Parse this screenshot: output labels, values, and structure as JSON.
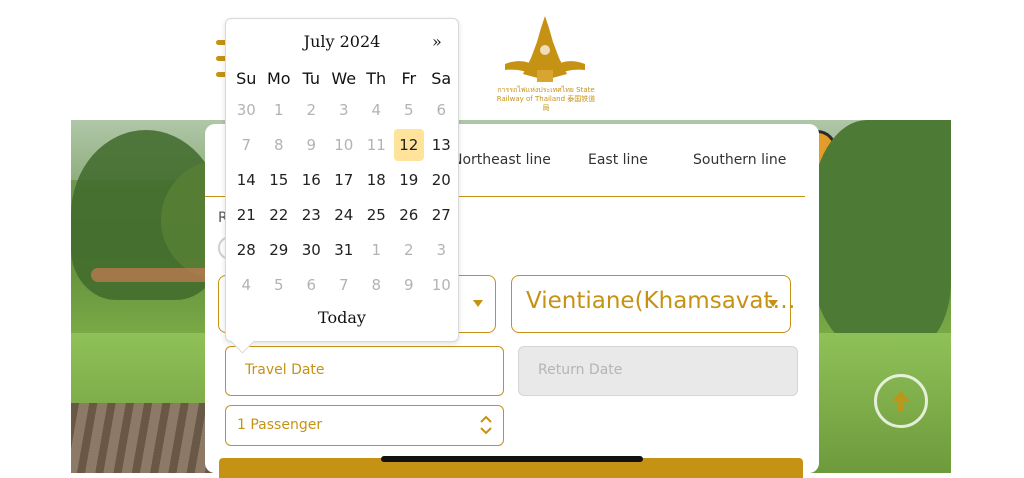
{
  "header": {
    "logo_caption": "การรถไฟแห่งประเทศไทย State Railway of Thailand 泰国铁道局"
  },
  "tabs": [
    "Northeast line",
    "East line",
    "Southern line"
  ],
  "round_label": "R",
  "from_select": {
    "value": ""
  },
  "to_select": {
    "value": "Vientiane(Khamsavat…"
  },
  "travel_date": {
    "placeholder": "Travel Date"
  },
  "return_date": {
    "placeholder": "Return Date"
  },
  "passenger": {
    "value": "1 Passenger"
  },
  "calendar": {
    "title": "July 2024",
    "next": "»",
    "days_of_week": [
      "Su",
      "Mo",
      "Tu",
      "We",
      "Th",
      "Fr",
      "Sa"
    ],
    "weeks": [
      [
        "30",
        "1",
        "2",
        "3",
        "4",
        "5",
        "6"
      ],
      [
        "7",
        "8",
        "9",
        "10",
        "11",
        "12",
        "13"
      ],
      [
        "14",
        "15",
        "16",
        "17",
        "18",
        "19",
        "20"
      ],
      [
        "21",
        "22",
        "23",
        "24",
        "25",
        "26",
        "27"
      ],
      [
        "28",
        "29",
        "30",
        "31",
        "1",
        "2",
        "3"
      ],
      [
        "4",
        "5",
        "6",
        "7",
        "8",
        "9",
        "10"
      ]
    ],
    "today_button": "Today",
    "selected_day": "12"
  },
  "colors": {
    "accent": "#c69214",
    "highlight": "#ffe39a"
  }
}
